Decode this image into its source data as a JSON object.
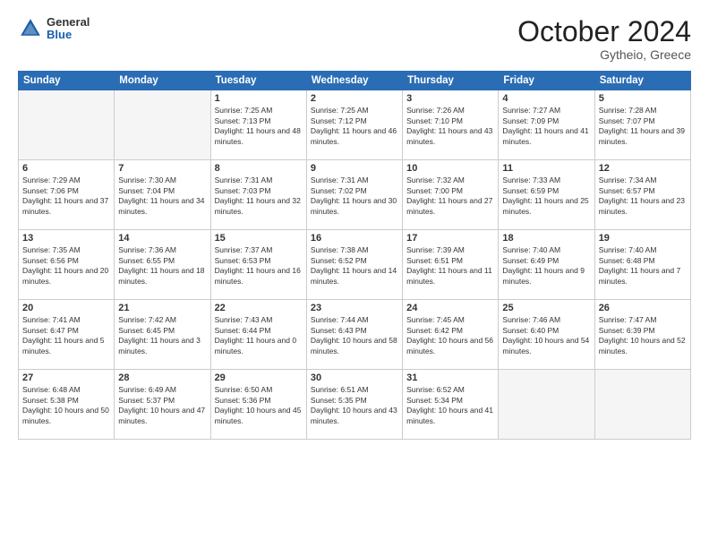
{
  "header": {
    "logo": {
      "general": "General",
      "blue": "Blue"
    },
    "title": "October 2024",
    "location": "Gytheio, Greece"
  },
  "days_of_week": [
    "Sunday",
    "Monday",
    "Tuesday",
    "Wednesday",
    "Thursday",
    "Friday",
    "Saturday"
  ],
  "weeks": [
    [
      {
        "day": "",
        "empty": true
      },
      {
        "day": "",
        "empty": true
      },
      {
        "day": "1",
        "sunrise": "7:25 AM",
        "sunset": "7:13 PM",
        "daylight": "11 hours and 48 minutes."
      },
      {
        "day": "2",
        "sunrise": "7:25 AM",
        "sunset": "7:12 PM",
        "daylight": "11 hours and 46 minutes."
      },
      {
        "day": "3",
        "sunrise": "7:26 AM",
        "sunset": "7:10 PM",
        "daylight": "11 hours and 43 minutes."
      },
      {
        "day": "4",
        "sunrise": "7:27 AM",
        "sunset": "7:09 PM",
        "daylight": "11 hours and 41 minutes."
      },
      {
        "day": "5",
        "sunrise": "7:28 AM",
        "sunset": "7:07 PM",
        "daylight": "11 hours and 39 minutes."
      }
    ],
    [
      {
        "day": "6",
        "sunrise": "7:29 AM",
        "sunset": "7:06 PM",
        "daylight": "11 hours and 37 minutes."
      },
      {
        "day": "7",
        "sunrise": "7:30 AM",
        "sunset": "7:04 PM",
        "daylight": "11 hours and 34 minutes."
      },
      {
        "day": "8",
        "sunrise": "7:31 AM",
        "sunset": "7:03 PM",
        "daylight": "11 hours and 32 minutes."
      },
      {
        "day": "9",
        "sunrise": "7:31 AM",
        "sunset": "7:02 PM",
        "daylight": "11 hours and 30 minutes."
      },
      {
        "day": "10",
        "sunrise": "7:32 AM",
        "sunset": "7:00 PM",
        "daylight": "11 hours and 27 minutes."
      },
      {
        "day": "11",
        "sunrise": "7:33 AM",
        "sunset": "6:59 PM",
        "daylight": "11 hours and 25 minutes."
      },
      {
        "day": "12",
        "sunrise": "7:34 AM",
        "sunset": "6:57 PM",
        "daylight": "11 hours and 23 minutes."
      }
    ],
    [
      {
        "day": "13",
        "sunrise": "7:35 AM",
        "sunset": "6:56 PM",
        "daylight": "11 hours and 20 minutes."
      },
      {
        "day": "14",
        "sunrise": "7:36 AM",
        "sunset": "6:55 PM",
        "daylight": "11 hours and 18 minutes."
      },
      {
        "day": "15",
        "sunrise": "7:37 AM",
        "sunset": "6:53 PM",
        "daylight": "11 hours and 16 minutes."
      },
      {
        "day": "16",
        "sunrise": "7:38 AM",
        "sunset": "6:52 PM",
        "daylight": "11 hours and 14 minutes."
      },
      {
        "day": "17",
        "sunrise": "7:39 AM",
        "sunset": "6:51 PM",
        "daylight": "11 hours and 11 minutes."
      },
      {
        "day": "18",
        "sunrise": "7:40 AM",
        "sunset": "6:49 PM",
        "daylight": "11 hours and 9 minutes."
      },
      {
        "day": "19",
        "sunrise": "7:40 AM",
        "sunset": "6:48 PM",
        "daylight": "11 hours and 7 minutes."
      }
    ],
    [
      {
        "day": "20",
        "sunrise": "7:41 AM",
        "sunset": "6:47 PM",
        "daylight": "11 hours and 5 minutes."
      },
      {
        "day": "21",
        "sunrise": "7:42 AM",
        "sunset": "6:45 PM",
        "daylight": "11 hours and 3 minutes."
      },
      {
        "day": "22",
        "sunrise": "7:43 AM",
        "sunset": "6:44 PM",
        "daylight": "11 hours and 0 minutes."
      },
      {
        "day": "23",
        "sunrise": "7:44 AM",
        "sunset": "6:43 PM",
        "daylight": "10 hours and 58 minutes."
      },
      {
        "day": "24",
        "sunrise": "7:45 AM",
        "sunset": "6:42 PM",
        "daylight": "10 hours and 56 minutes."
      },
      {
        "day": "25",
        "sunrise": "7:46 AM",
        "sunset": "6:40 PM",
        "daylight": "10 hours and 54 minutes."
      },
      {
        "day": "26",
        "sunrise": "7:47 AM",
        "sunset": "6:39 PM",
        "daylight": "10 hours and 52 minutes."
      }
    ],
    [
      {
        "day": "27",
        "sunrise": "6:48 AM",
        "sunset": "5:38 PM",
        "daylight": "10 hours and 50 minutes."
      },
      {
        "day": "28",
        "sunrise": "6:49 AM",
        "sunset": "5:37 PM",
        "daylight": "10 hours and 47 minutes."
      },
      {
        "day": "29",
        "sunrise": "6:50 AM",
        "sunset": "5:36 PM",
        "daylight": "10 hours and 45 minutes."
      },
      {
        "day": "30",
        "sunrise": "6:51 AM",
        "sunset": "5:35 PM",
        "daylight": "10 hours and 43 minutes."
      },
      {
        "day": "31",
        "sunrise": "6:52 AM",
        "sunset": "5:34 PM",
        "daylight": "10 hours and 41 minutes."
      },
      {
        "day": "",
        "empty": true
      },
      {
        "day": "",
        "empty": true
      }
    ]
  ]
}
